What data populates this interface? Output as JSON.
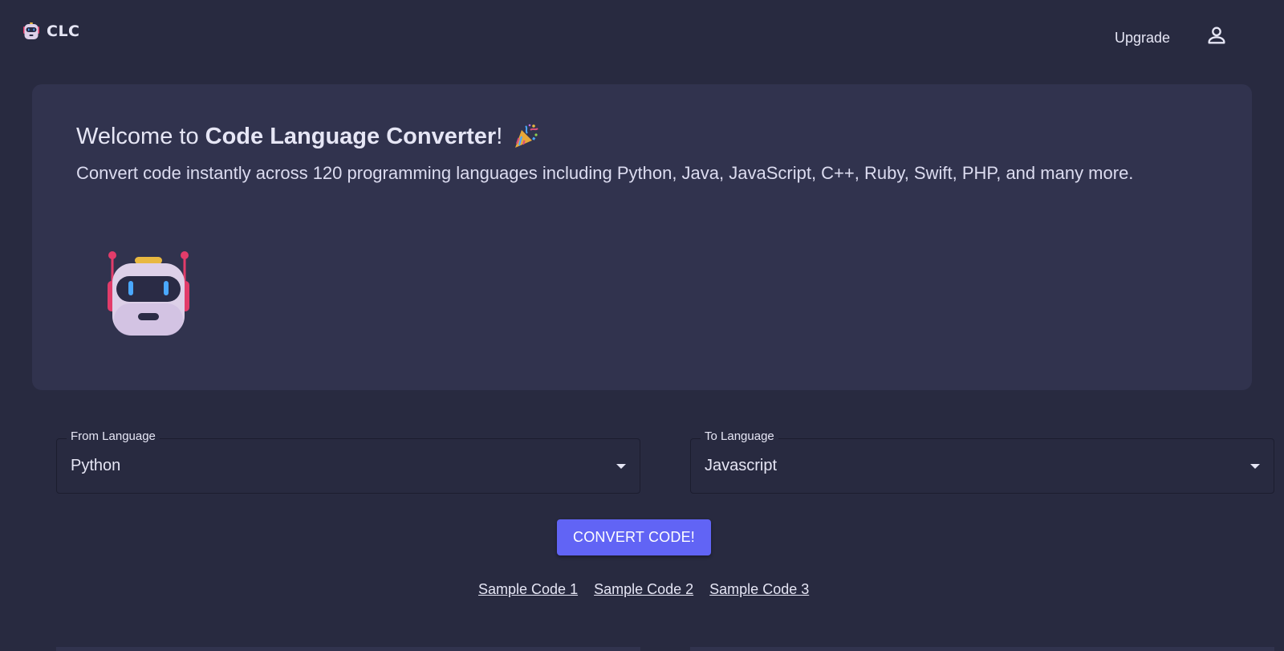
{
  "header": {
    "brand": "CLC",
    "upgrade_label": "Upgrade",
    "user_icon": "user-icon"
  },
  "hero": {
    "title_prefix": "Welcome to ",
    "title_bold": "Code Language Converter",
    "title_suffix": "!",
    "subtitle": "Convert code instantly across 120 programming languages including Python, Java, JavaScript, C++, Ruby, Swift, PHP, and many more.",
    "icons": [
      "party-popper-icon",
      "robot-icon"
    ]
  },
  "from_language": {
    "label": "From Language",
    "value": "Python"
  },
  "to_language": {
    "label": "To Language",
    "value": "Javascript"
  },
  "convert_button": {
    "label": "CONVERT CODE!"
  },
  "samples": [
    {
      "label": "Sample Code 1"
    },
    {
      "label": "Sample Code 2"
    },
    {
      "label": "Sample Code 3"
    }
  ],
  "colors": {
    "background": "#282a40",
    "panel": "#31334e",
    "accent": "#6164f5",
    "text": "#e6e6f5"
  }
}
